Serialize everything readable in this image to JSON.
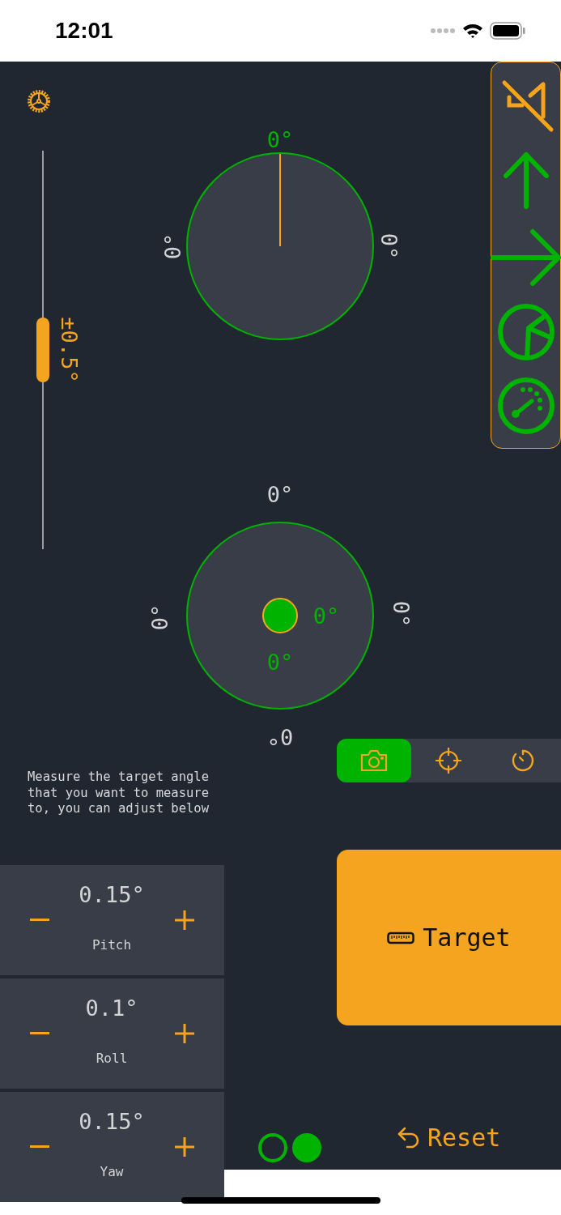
{
  "status_bar": {
    "time": "12:01"
  },
  "tolerance_slider": {
    "label": "±0.5°",
    "level": 0.5
  },
  "side_toolbar": [
    {
      "kind": "mute"
    },
    {
      "kind": "arrow-up"
    },
    {
      "kind": "arrow-right"
    },
    {
      "kind": "pie"
    },
    {
      "kind": "gauge"
    }
  ],
  "compass_dial": {
    "top_reading": "0°",
    "left_reading": "0°",
    "right_reading": "0°"
  },
  "level_dial": {
    "top_reading": "0°",
    "left_reading": "0°",
    "right_reading": "0°",
    "bottom_reading": "0°",
    "bubble_x_reading": "0°",
    "bubble_y_reading": "0°"
  },
  "mode_tabs": [
    {
      "kind": "camera",
      "selected": true
    },
    {
      "kind": "crosshair",
      "selected": false
    },
    {
      "kind": "timer",
      "selected": false
    }
  ],
  "instructions": "Measure the target angle that you want to measure to, you can adjust below",
  "adjusters": [
    {
      "value": "0.15°",
      "label": "Pitch"
    },
    {
      "value": "0.1°",
      "label": "Roll"
    },
    {
      "value": "0.15°",
      "label": "Yaw"
    }
  ],
  "target_button": {
    "label": "Target"
  },
  "reset_button": {
    "label": "Reset"
  },
  "page_dots": [
    {
      "selected": false
    },
    {
      "selected": true
    }
  ]
}
